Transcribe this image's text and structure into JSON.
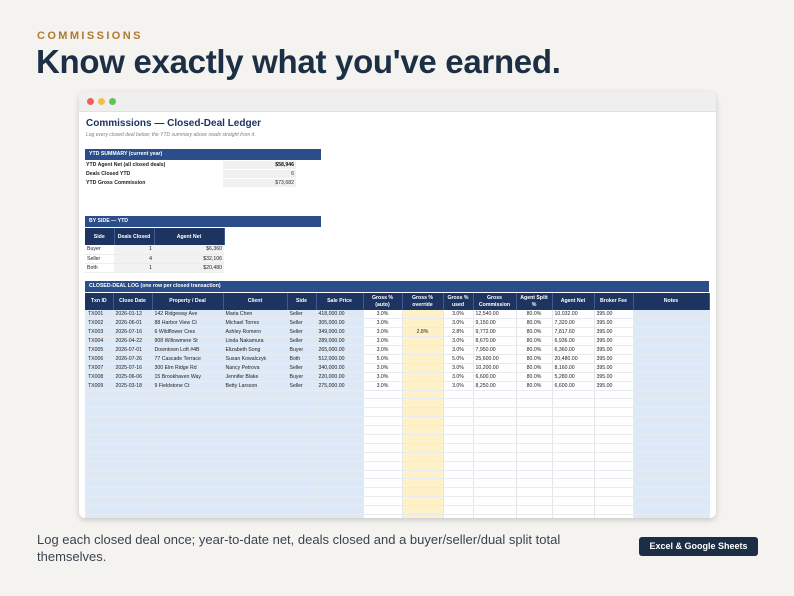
{
  "page": {
    "eyebrow": "COMMISSIONS",
    "headline": "Know exactly what you've earned.",
    "caption": "Log each closed deal once; year-to-date net, deals closed and a buyer/seller/dual split total themselves.",
    "badge": "Excel & Google Sheets"
  },
  "colors": {
    "accent_gold": "#b07a2e",
    "header_navy": "#1d3461",
    "band_blue": "#2b4d8a",
    "input_blue": "#dde9f6",
    "override_yellow": "#fff1c7",
    "badge_bg": "#1d2d45"
  },
  "window": {
    "controls": [
      "close-dot",
      "minimize-dot",
      "zoom-dot"
    ]
  },
  "sheet": {
    "title": "Commissions — Closed-Deal Ledger",
    "subtitle": "Log every closed deal below; the YTD summary above reads straight from it.",
    "ytd": {
      "header": "YTD SUMMARY  (current year)",
      "rows": [
        {
          "label": "YTD Agent Net (all closed deals)",
          "value": "$58,946"
        },
        {
          "label": "Deals Closed YTD",
          "value": "6"
        },
        {
          "label": "YTD Gross Commission",
          "value": "$73,682"
        }
      ]
    },
    "by_side": {
      "header": "BY SIDE — YTD",
      "columns": [
        "Side",
        "Deals Closed",
        "Agent Net"
      ],
      "rows": [
        [
          "Buyer",
          "1",
          "$6,360"
        ],
        [
          "Seller",
          "4",
          "$32,106"
        ],
        [
          "Both",
          "1",
          "$20,480"
        ]
      ]
    },
    "log": {
      "header": "CLOSED-DEAL LOG  (one row per closed transaction)",
      "columns": [
        "Txn ID",
        "Close Date",
        "Property / Deal",
        "Client",
        "Side",
        "Sale Price",
        "Gross % (auto)",
        "Gross % override",
        "Gross % used",
        "Gross Commission",
        "Agent Split %",
        "Agent Net",
        "Broker Fee",
        "Notes"
      ],
      "rows": [
        [
          "TX001",
          "2026-01-12",
          "142 Ridgeway Ave",
          "Maria Chen",
          "Seller",
          "418,000.00",
          "3.0%",
          "",
          "3.0%",
          "12,540.00",
          "80.0%",
          "10,032.00",
          "395.00",
          ""
        ],
        [
          "TX002",
          "2026-06-01",
          "88 Harbor View Ct",
          "Michael Torres",
          "Seller",
          "305,000.00",
          "3.0%",
          "",
          "3.0%",
          "9,150.00",
          "80.0%",
          "7,320.00",
          "395.00",
          ""
        ],
        [
          "TX003",
          "2026-07-16",
          "6 Wildflower Cres",
          "Ashley Romero",
          "Seller",
          "349,000.00",
          "3.0%",
          "2.8%",
          "2.8%",
          "9,772.00",
          "80.0%",
          "7,817.60",
          "395.00",
          ""
        ],
        [
          "TX004",
          "2026-04-22",
          "908 Willowmere St",
          "Linda Nakamura",
          "Seller",
          "289,000.00",
          "3.0%",
          "",
          "3.0%",
          "8,670.00",
          "80.0%",
          "6,936.00",
          "395.00",
          ""
        ],
        [
          "TX005",
          "2026-07-01",
          "Downtown Loft #4B",
          "Elizabeth Song",
          "Buyer",
          "265,000.00",
          "3.0%",
          "",
          "3.0%",
          "7,950.00",
          "80.0%",
          "6,360.00",
          "395.00",
          ""
        ],
        [
          "TX006",
          "2026-07-26",
          "77 Cascade Terrace",
          "Susan Kowalczyk",
          "Both",
          "512,000.00",
          "5.0%",
          "",
          "5.0%",
          "25,600.00",
          "80.0%",
          "20,480.00",
          "395.00",
          ""
        ],
        [
          "TX007",
          "2025-07-16",
          "300 Elm Ridge Rd",
          "Nancy Petrova",
          "Seller",
          "340,000.00",
          "3.0%",
          "",
          "3.0%",
          "10,200.00",
          "80.0%",
          "8,160.00",
          "395.00",
          ""
        ],
        [
          "TX008",
          "2025-06-06",
          "15 Brookhaven Way",
          "Jennifer Blake",
          "Buyer",
          "220,000.00",
          "3.0%",
          "",
          "3.0%",
          "6,600.00",
          "80.0%",
          "5,280.00",
          "395.00",
          ""
        ],
        [
          "TX009",
          "2025-03-18",
          "9 Fieldstone Ct",
          "Betty Larsson",
          "Seller",
          "275,000.00",
          "3.0%",
          "",
          "3.0%",
          "8,250.00",
          "80.0%",
          "6,600.00",
          "395.00",
          ""
        ]
      ]
    }
  }
}
